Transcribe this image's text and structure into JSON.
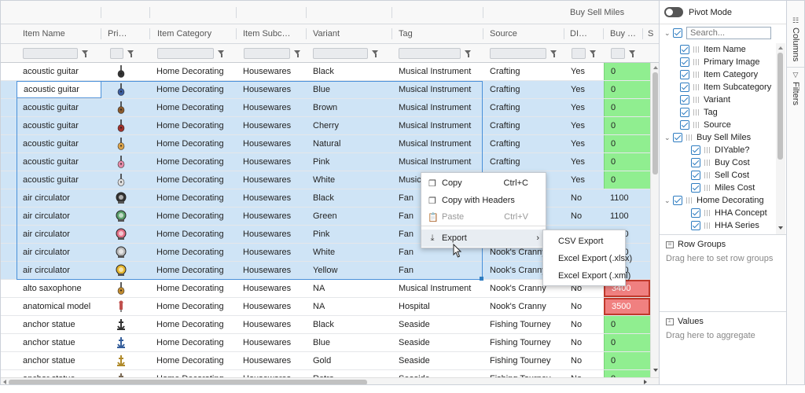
{
  "group_header": {
    "label": "Buy Sell Miles"
  },
  "columns": [
    {
      "key": "name",
      "label": "Item Name"
    },
    {
      "key": "image",
      "label": "Pri…"
    },
    {
      "key": "category",
      "label": "Item Category"
    },
    {
      "key": "subcat",
      "label": "Item Subc…"
    },
    {
      "key": "variant",
      "label": "Variant"
    },
    {
      "key": "tag",
      "label": "Tag"
    },
    {
      "key": "source",
      "label": "Source"
    },
    {
      "key": "diy",
      "label": "DI…"
    },
    {
      "key": "buy",
      "label": "Buy …"
    },
    {
      "key": "s",
      "label": "S"
    }
  ],
  "rows": [
    {
      "name": "acoustic guitar",
      "image": "guitar-black-icon",
      "category": "Home Decorating",
      "subcat": "Housewares",
      "variant": "Black",
      "tag": "Musical Instrument",
      "source": "Crafting",
      "diy": "Yes",
      "buy": "0",
      "selected": false,
      "buy_style": "green"
    },
    {
      "name": "acoustic guitar",
      "image": "guitar-blue-icon",
      "category": "Home Decorating",
      "subcat": "Housewares",
      "variant": "Blue",
      "tag": "Musical Instrument",
      "source": "Crafting",
      "diy": "Yes",
      "buy": "0",
      "selected": true,
      "buy_style": "green"
    },
    {
      "name": "acoustic guitar",
      "image": "guitar-brown-icon",
      "category": "Home Decorating",
      "subcat": "Housewares",
      "variant": "Brown",
      "tag": "Musical Instrument",
      "source": "Crafting",
      "diy": "Yes",
      "buy": "0",
      "selected": true,
      "buy_style": "green"
    },
    {
      "name": "acoustic guitar",
      "image": "guitar-cherry-icon",
      "category": "Home Decorating",
      "subcat": "Housewares",
      "variant": "Cherry",
      "tag": "Musical Instrument",
      "source": "Crafting",
      "diy": "Yes",
      "buy": "0",
      "selected": true,
      "buy_style": "green"
    },
    {
      "name": "acoustic guitar",
      "image": "guitar-natural-icon",
      "category": "Home Decorating",
      "subcat": "Housewares",
      "variant": "Natural",
      "tag": "Musical Instrument",
      "source": "Crafting",
      "diy": "Yes",
      "buy": "0",
      "selected": true,
      "buy_style": "green"
    },
    {
      "name": "acoustic guitar",
      "image": "guitar-pink-icon",
      "category": "Home Decorating",
      "subcat": "Housewares",
      "variant": "Pink",
      "tag": "Musical Instrument",
      "source": "Crafting",
      "diy": "Yes",
      "buy": "0",
      "selected": true,
      "buy_style": "green"
    },
    {
      "name": "acoustic guitar",
      "image": "guitar-white-icon",
      "category": "Home Decorating",
      "subcat": "Housewares",
      "variant": "White",
      "tag": "Musical Instrument",
      "source": "Crafting",
      "diy": "Yes",
      "buy": "0",
      "selected": true,
      "buy_style": "green"
    },
    {
      "name": "air circulator",
      "image": "fan-black-icon",
      "category": "Home Decorating",
      "subcat": "Housewares",
      "variant": "Black",
      "tag": "Fan",
      "source": "Nook's Cranny",
      "diy": "No",
      "buy": "1100",
      "selected": true,
      "buy_style": "plain"
    },
    {
      "name": "air circulator",
      "image": "fan-green-icon",
      "category": "Home Decorating",
      "subcat": "Housewares",
      "variant": "Green",
      "tag": "Fan",
      "source": "Nook's Cranny",
      "diy": "No",
      "buy": "1100",
      "selected": true,
      "buy_style": "plain"
    },
    {
      "name": "air circulator",
      "image": "fan-pink-icon",
      "category": "Home Decorating",
      "subcat": "Housewares",
      "variant": "Pink",
      "tag": "Fan",
      "source": "Nook's Cranny",
      "diy": "No",
      "buy": "1100",
      "selected": true,
      "buy_style": "plain"
    },
    {
      "name": "air circulator",
      "image": "fan-white-icon",
      "category": "Home Decorating",
      "subcat": "Housewares",
      "variant": "White",
      "tag": "Fan",
      "source": "Nook's Cranny",
      "diy": "No",
      "buy": "1100",
      "selected": true,
      "buy_style": "plain"
    },
    {
      "name": "air circulator",
      "image": "fan-yellow-icon",
      "category": "Home Decorating",
      "subcat": "Housewares",
      "variant": "Yellow",
      "tag": "Fan",
      "source": "Nook's Cranny",
      "diy": "No",
      "buy": "1100",
      "selected": true,
      "buy_style": "plain"
    },
    {
      "name": "alto saxophone",
      "image": "saxophone-icon",
      "category": "Home Decorating",
      "subcat": "Housewares",
      "variant": "NA",
      "tag": "Musical Instrument",
      "source": "Nook's Cranny",
      "diy": "No",
      "buy": "3400",
      "selected": false,
      "buy_style": "red"
    },
    {
      "name": "anatomical model",
      "image": "anatomical-model-icon",
      "category": "Home Decorating",
      "subcat": "Housewares",
      "variant": "NA",
      "tag": "Hospital",
      "source": "Nook's Cranny",
      "diy": "No",
      "buy": "3500",
      "selected": false,
      "buy_style": "red"
    },
    {
      "name": "anchor statue",
      "image": "anchor-black-icon",
      "category": "Home Decorating",
      "subcat": "Housewares",
      "variant": "Black",
      "tag": "Seaside",
      "source": "Fishing Tourney",
      "diy": "No",
      "buy": "0",
      "selected": false,
      "buy_style": "green"
    },
    {
      "name": "anchor statue",
      "image": "anchor-blue-icon",
      "category": "Home Decorating",
      "subcat": "Housewares",
      "variant": "Blue",
      "tag": "Seaside",
      "source": "Fishing Tourney",
      "diy": "No",
      "buy": "0",
      "selected": false,
      "buy_style": "green"
    },
    {
      "name": "anchor statue",
      "image": "anchor-gold-icon",
      "category": "Home Decorating",
      "subcat": "Housewares",
      "variant": "Gold",
      "tag": "Seaside",
      "source": "Fishing Tourney",
      "diy": "No",
      "buy": "0",
      "selected": false,
      "buy_style": "green"
    },
    {
      "name": "anchor statue",
      "image": "anchor-retro-icon",
      "category": "Home Decorating",
      "subcat": "Housewares",
      "variant": "Retro",
      "tag": "Seaside",
      "source": "Fishing Tourney",
      "diy": "No",
      "buy": "0",
      "selected": false,
      "buy_style": "green"
    }
  ],
  "context_menu": {
    "copy": {
      "label": "Copy",
      "shortcut": "Ctrl+C"
    },
    "copy_headers": {
      "label": "Copy with Headers"
    },
    "paste": {
      "label": "Paste",
      "shortcut": "Ctrl+V"
    },
    "export": {
      "label": "Export"
    }
  },
  "export_submenu": [
    "CSV Export",
    "Excel Export (.xlsx)",
    "Excel Export (.xml)"
  ],
  "side_panel": {
    "pivot_mode": "Pivot Mode",
    "search_placeholder": "Search...",
    "columns": [
      {
        "label": "Item Name",
        "level": 1,
        "group": false
      },
      {
        "label": "Primary Image",
        "level": 1,
        "group": false
      },
      {
        "label": "Item Category",
        "level": 1,
        "group": false
      },
      {
        "label": "Item Subcategory",
        "level": 1,
        "group": false
      },
      {
        "label": "Variant",
        "level": 1,
        "group": false
      },
      {
        "label": "Tag",
        "level": 1,
        "group": false
      },
      {
        "label": "Source",
        "level": 1,
        "group": false
      },
      {
        "label": "Buy Sell Miles",
        "level": 0,
        "group": true
      },
      {
        "label": "DIYable?",
        "level": 2,
        "group": false
      },
      {
        "label": "Buy Cost",
        "level": 2,
        "group": false
      },
      {
        "label": "Sell Cost",
        "level": 2,
        "group": false
      },
      {
        "label": "Miles Cost",
        "level": 2,
        "group": false
      },
      {
        "label": "Home Decorating",
        "level": 0,
        "group": true
      },
      {
        "label": "HHA Concept",
        "level": 2,
        "group": false
      },
      {
        "label": "HHA Series",
        "level": 2,
        "group": false
      }
    ],
    "row_groups": {
      "title": "Row Groups",
      "hint": "Drag here to set row groups"
    },
    "values": {
      "title": "Values",
      "hint": "Drag here to aggregate"
    }
  },
  "tabs": [
    {
      "label": "Columns"
    },
    {
      "label": "Filters"
    }
  ],
  "colors": {
    "selection": "#cfe4f6",
    "green": "#90ee90",
    "red": "#f08080",
    "accent": "#2f7dc1"
  }
}
